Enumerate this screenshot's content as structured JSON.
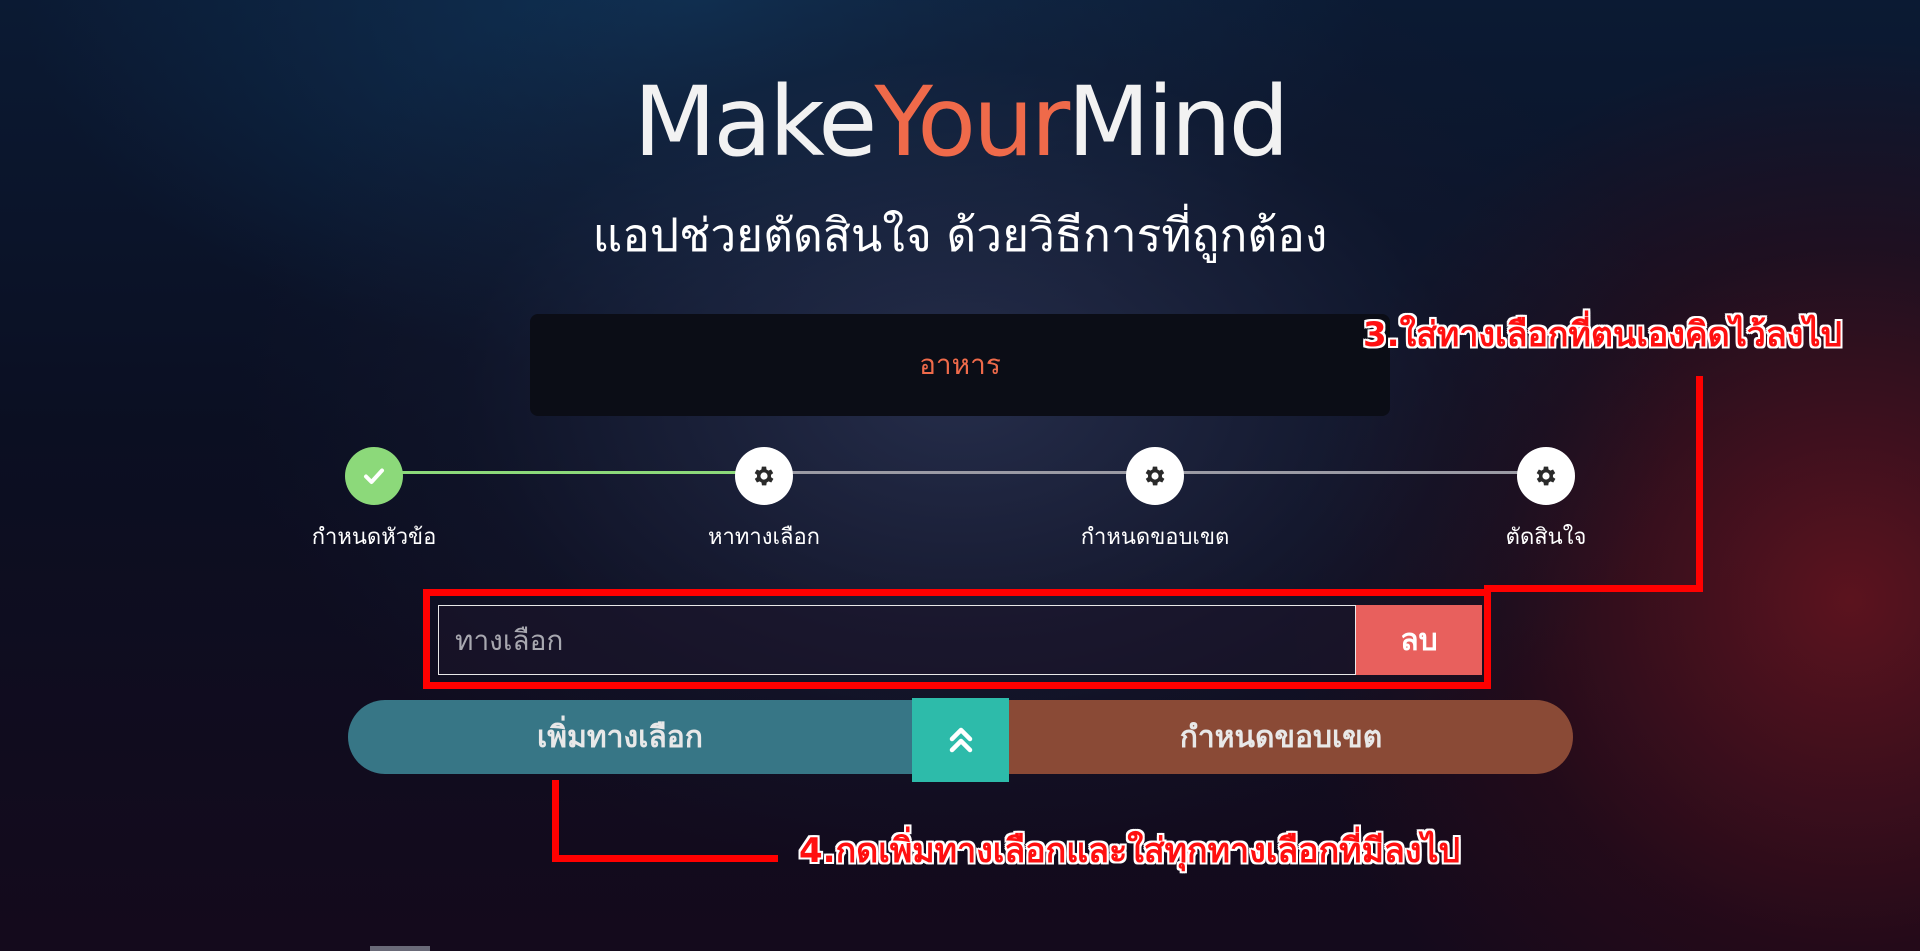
{
  "header": {
    "logo_part1": "Make",
    "logo_part2": "Your",
    "logo_part3": "Mind",
    "subtitle": "แอปช่วยตัดสินใจ ด้วยวิธีการที่ถูกต้อง"
  },
  "topic": {
    "value": "อาหาร"
  },
  "steps": [
    {
      "label": "กำหนดหัวข้อ",
      "state": "done",
      "icon": "check-icon"
    },
    {
      "label": "หาทางเลือก",
      "state": "pending",
      "icon": "gear-icon"
    },
    {
      "label": "กำหนดขอบเขต",
      "state": "pending",
      "icon": "gear-icon"
    },
    {
      "label": "ตัดสินใจ",
      "state": "pending",
      "icon": "gear-icon"
    }
  ],
  "option_form": {
    "placeholder": "ทางเลือก",
    "value": "",
    "delete_label": "ลบ"
  },
  "actions": {
    "add_label": "เพิ่มทางเลือก",
    "up_icon": "double-chevron-up-icon",
    "limit_label": "กำหนดขอบเขต"
  },
  "annotations": {
    "step3": "3.ใส่ทางเลือกที่ตนเองคิดไว้ลงไป",
    "step4": "4.กดเพิ่มทางเลือกและใส่ทุกทางเลือกที่มีลงไป"
  },
  "colors": {
    "accent": "#ef6a4a",
    "done": "#8cd97a",
    "add_button": "#377686",
    "up_button": "#2dbbaa",
    "limit_button": "#8a4a36",
    "delete_button": "#e8605d",
    "annotation": "#ff0000"
  }
}
